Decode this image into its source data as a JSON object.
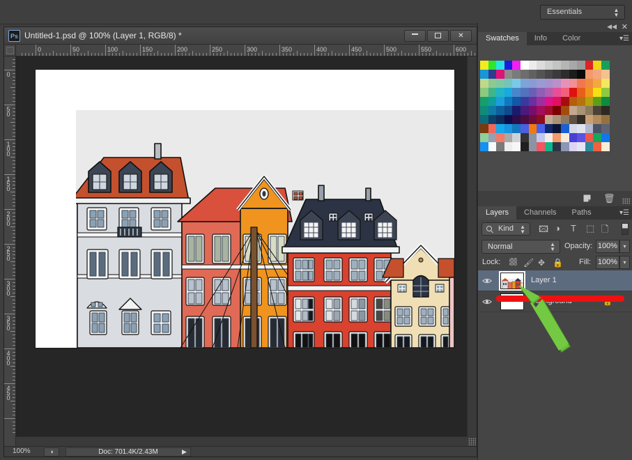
{
  "appbar": {
    "workspace": "Essentials",
    "workspace_icon": "updown-arrows-icon"
  },
  "document_window": {
    "app_badge": "Ps",
    "title": "Untitled-1.psd @ 100% (Layer 1, RGB/8) *",
    "buttons": {
      "minimize": "minimize-icon",
      "maximize": "maximize-icon",
      "close": "✕"
    },
    "ruler_horizontal": {
      "labels": [
        "0",
        "50",
        "100",
        "150",
        "200",
        "250",
        "300",
        "350",
        "400",
        "450",
        "500",
        "550",
        "600"
      ]
    },
    "ruler_vertical": {
      "labels": [
        "50",
        "0",
        "50",
        "100",
        "150",
        "200",
        "250",
        "300",
        "350",
        "400",
        "450"
      ]
    }
  },
  "statusbar": {
    "zoom": "100%",
    "preview_icon": "preview-icon",
    "doc_info": "Doc: 701.4K/2.43M",
    "expand_arrow": "▶"
  },
  "dock": {
    "collapse_icon": "◀◀",
    "close_icon": "✕"
  },
  "swatches_panel": {
    "tabs": [
      {
        "label": "Swatches",
        "active": true
      },
      {
        "label": "Info",
        "active": false
      },
      {
        "label": "Color",
        "active": false
      }
    ],
    "menu_icon": "panel-menu-icon",
    "grid": [
      [
        "#f2ec1e",
        "#2ee62e",
        "#29e3e3",
        "#1b1bdb",
        "#f21ff2",
        "#ffffff",
        "#ececec",
        "#dcdcdc",
        "#cfcfcf",
        "#c4c4c4",
        "#b5b5b5",
        "#a8a8a8",
        "#9b9b9b",
        "#e02222",
        "#f0d51c",
        "#17a05a"
      ],
      [
        "#1796d8",
        "#2f3c8c",
        "#e0117b",
        "#8c8c8c",
        "#7a7a7a",
        "#6e6e6e",
        "#616161",
        "#545454",
        "#474747",
        "#3b3b3b",
        "#2d2d2d",
        "#1c1c1c",
        "#0a0a0a",
        "#f29a6b",
        "#f2a77f",
        "#f5c18f"
      ],
      [
        "#bdd98c",
        "#8fc98f",
        "#7ec9a3",
        "#72c4bd",
        "#79c9e8",
        "#7ea3d8",
        "#8a9bd4",
        "#9b9bd4",
        "#a891cf",
        "#bd8fc9",
        "#e891b8",
        "#ef8f96",
        "#f2774f",
        "#ef8c3f",
        "#f2a83f",
        "#f2e85f"
      ],
      [
        "#8dc97e",
        "#3fb58c",
        "#22b5c4",
        "#19a8e0",
        "#4a86c9",
        "#5273bd",
        "#6b5fb5",
        "#8f5fb5",
        "#b05fb0",
        "#e84f96",
        "#f25f7a",
        "#e01111",
        "#e85f1b",
        "#f2941b",
        "#f2e211",
        "#8fc93f"
      ],
      [
        "#13a06b",
        "#0e9e9e",
        "#1b9ede",
        "#1477bd",
        "#1158a8",
        "#3a3a9e",
        "#6b2f9e",
        "#9e2f9e",
        "#e0118c",
        "#e01160",
        "#a60d0d",
        "#b55c0d",
        "#b5730d",
        "#b5a00d",
        "#5c9e1b",
        "#0d8c3f"
      ],
      [
        "#0e8c7a",
        "#0e7aa8",
        "#0e5f9e",
        "#0e4a8c",
        "#1b1b6b",
        "#4a1b7a",
        "#7a0d6b",
        "#a30d5c",
        "#a30d2d",
        "#7a0000",
        "#a34a0d",
        "#c2a88f",
        "#a89377",
        "#8c7a5c",
        "#4a4235",
        "#2e2a22"
      ],
      [
        "#0e6b7a",
        "#0d3f6b",
        "#0d2a5c",
        "#0d0d4a",
        "#2d0d4a",
        "#4a0d3f",
        "#6b0d3a",
        "#8c0d1b",
        "#c2a88f",
        "#a89377",
        "#8c7760",
        "#5c5244",
        "#332e26",
        "#c9a074",
        "#b08a5c",
        "#96713f"
      ],
      [
        "#7a3a0d",
        "#f2675c",
        "#13a8e8",
        "#1793e0",
        "#1577bd",
        "#4a60e0",
        "#f27a0d",
        "#4a60e8",
        "#11296b",
        "#0d1433",
        "#1b5fd4",
        "#d4dae8",
        "#dfe3ee",
        "#b0b8cf",
        "#4a5264",
        "#5c6475"
      ],
      [
        "#8fcf9e",
        "#96a0b0",
        "#f27a6b",
        "#a8a8a8",
        "#ced2d8",
        "#333333",
        "#8c93a3",
        "#c2c9ef",
        "#f7ece4",
        "#f29a6b",
        "#f7ecd8",
        "#4a3fd4",
        "#5c52e0",
        "#f2564a",
        "#13a85c",
        "#1177e8"
      ],
      [
        "#1790ef",
        "#f7fafd",
        "#7a7a7a",
        "#ededed",
        "#f7f7f7",
        "#1f1f1f",
        "#8c93a3",
        "#f2565f",
        "#11b58c",
        "#2d3344",
        "#8c96b5",
        "#dcd4f2",
        "#e4e4f2",
        "#2a8c9e",
        "#f2603f",
        "#faeed4"
      ]
    ]
  },
  "layers_panel": {
    "top_icons": {
      "new_layer": "new-layer-icon",
      "delete_layer": "trash-icon",
      "resize_grip": "resize-grip-icon"
    },
    "tabs": [
      {
        "label": "Layers",
        "active": true
      },
      {
        "label": "Channels",
        "active": false
      },
      {
        "label": "Paths",
        "active": false
      }
    ],
    "menu_icon": "panel-menu-icon",
    "filter": {
      "search_icon": "search-icon",
      "kind": "Kind",
      "dropdown_icon": "updown-arrows-icon",
      "icons": [
        "pixel-layer-icon",
        "adjustment-layer-icon",
        "type-layer-icon",
        "shape-layer-icon",
        "smart-object-icon"
      ],
      "toggle_icon": "filter-toggle-icon"
    },
    "blend": {
      "mode": "Normal",
      "mode_dropdown_icon": "updown-arrows-icon",
      "opacity_label": "Opacity:",
      "opacity_value": "100%",
      "opacity_dropdown_icon": "chevron-down-icon"
    },
    "lock": {
      "label": "Lock:",
      "icons": [
        "lock-transparency-icon",
        "lock-image-icon",
        "lock-position-icon",
        "lock-all-icon"
      ],
      "fill_label": "Fill:",
      "fill_value": "100%",
      "fill_dropdown_icon": "chevron-down-icon"
    },
    "layers": [
      {
        "name": "Layer 1",
        "visible": true,
        "selected": true,
        "eye_icon": "eye-icon",
        "thumbnail": "buildings-thumbnail",
        "locked": false
      },
      {
        "name": "Background",
        "visible": true,
        "selected": false,
        "eye_icon": "eye-icon",
        "thumbnail": "white-thumbnail",
        "locked": true,
        "lock_icon": "lock-icon"
      }
    ]
  },
  "annotations": {
    "red_bar": {
      "color": "#ee1111",
      "name": "red-highlight-bar"
    },
    "green_arrow": {
      "color": "#6abf3e",
      "name": "green-pointer-arrow"
    }
  },
  "canvas": {
    "artwork_name": "nyhavn-buildings-illustration",
    "background_color": "#ffffff",
    "sky_color": "#eaeaea"
  }
}
